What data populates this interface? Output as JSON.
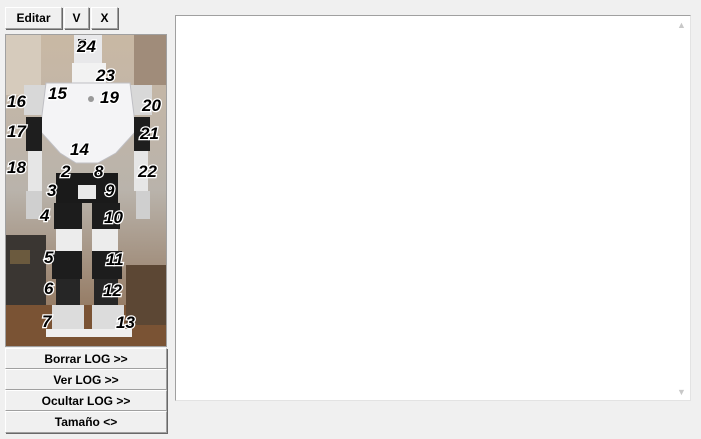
{
  "toolbar": {
    "edit_label": "Editar",
    "v_label": "V",
    "x_label": "X"
  },
  "robot_photo": {
    "servo_labels": [
      "24",
      "23",
      "15",
      "19",
      "16",
      "20",
      "17",
      "21",
      "14",
      "18",
      "22",
      "2",
      "8",
      "3",
      "9",
      "4",
      "10",
      "5",
      "11",
      "6",
      "12",
      "7",
      "13"
    ]
  },
  "log_buttons": {
    "clear_label": "Borrar LOG >>",
    "view_label": "Ver LOG >>",
    "hide_label": "Ocultar LOG >>",
    "size_label": "Tamaño <>"
  },
  "log": {
    "content": ""
  },
  "scrollbar": {
    "up_icon": "scroll-up-arrow",
    "down_icon": "scroll-down-arrow"
  }
}
